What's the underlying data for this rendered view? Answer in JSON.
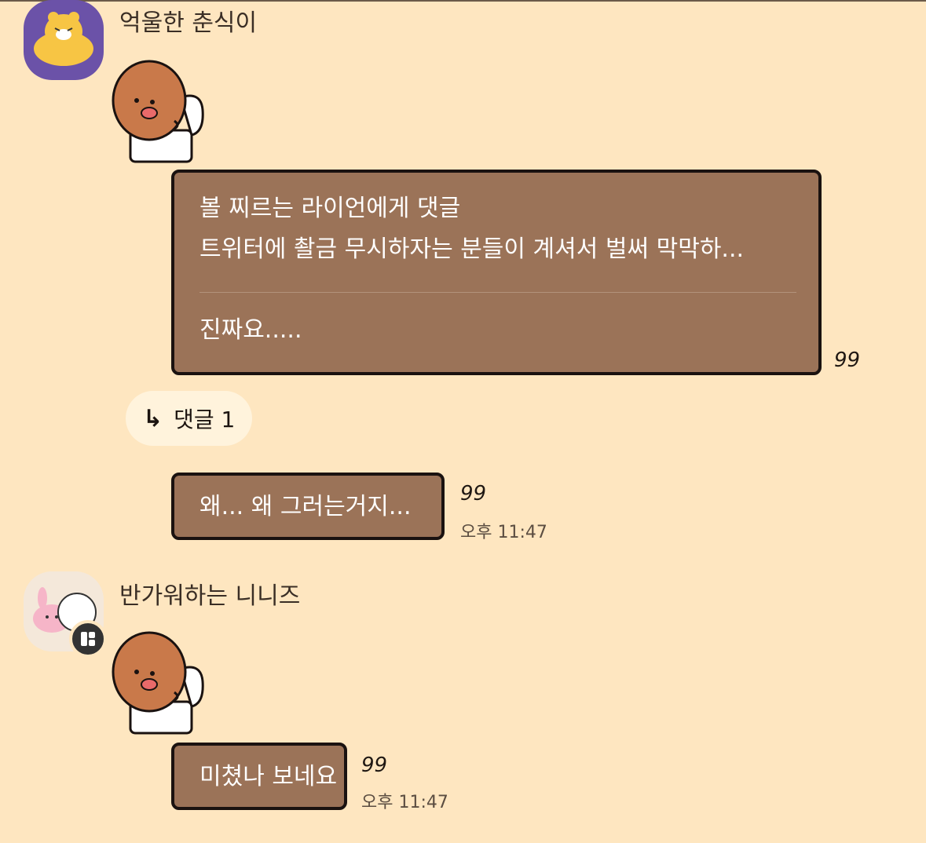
{
  "colors": {
    "background": "#fee6c0",
    "bubble": "#9b7358",
    "bubble_border": "#1a1210",
    "avatar1_bg": "#6b52a8",
    "avatar2_bg": "#f4e8da"
  },
  "messages": [
    {
      "sender": "억울한 춘식이",
      "avatar_icon": "ryan-character-avatar-icon",
      "sticker_icon": "choonsik-toilet-sticker-icon",
      "bubble_lines": [
        "볼 찌르는 라이언에게 댓글",
        "트위터에 촬금 무시하자는 분들이 계셔서 벌써 막막하..."
      ],
      "bubble_extra": "진짜요.....",
      "read_count": "99",
      "reply_label": "댓글 1",
      "reply_icon": "reply-arrow-icon"
    },
    {
      "text": "왜... 왜 그러는거지...",
      "read_count": "99",
      "time": "오후 11:47"
    },
    {
      "sender": "반가워하는 니니즈",
      "avatar_icon": "niniz-bunny-avatar-icon",
      "badge_icon": "kakao-profile-badge-icon",
      "sticker_icon": "choonsik-toilet-sticker-icon",
      "text": "미쳤나 보네요",
      "read_count": "99",
      "time": "오후 11:47"
    }
  ]
}
